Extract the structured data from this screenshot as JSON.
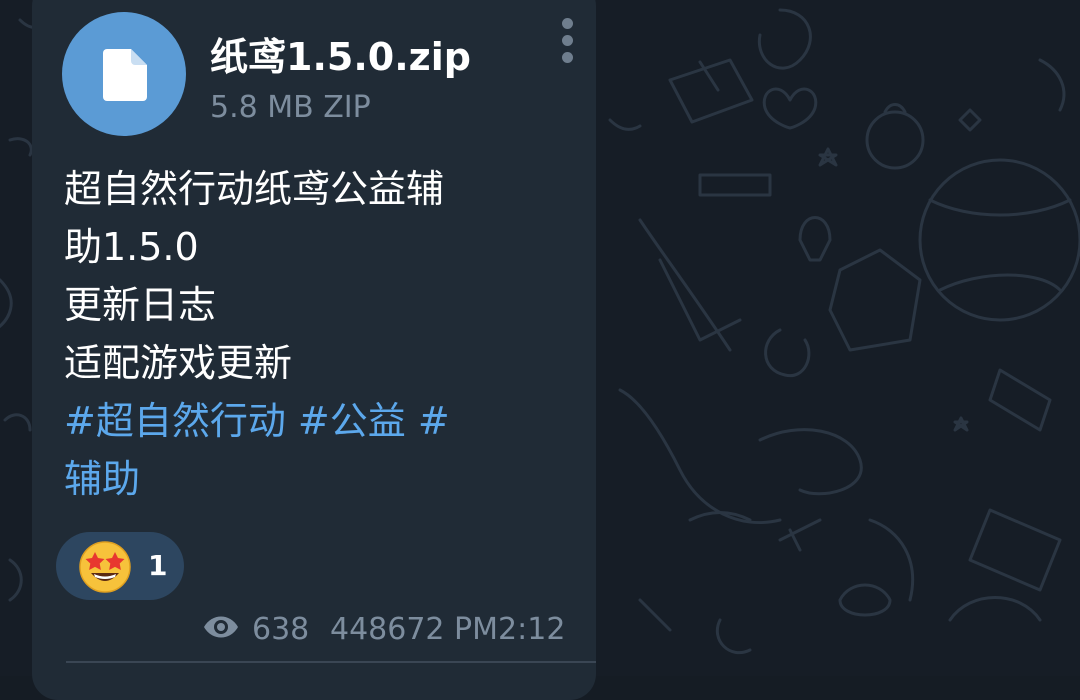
{
  "message": {
    "file": {
      "name": "纸鸢1.5.0.zip",
      "meta": "5.8 MB ZIP",
      "icon": "file-icon"
    },
    "caption_lines": [
      "超自然行动纸鸢公益辅",
      "助1.5.0",
      "更新日志",
      "适配游戏更新"
    ],
    "hashtag_lines": [
      "#超自然行动 #公益 #",
      "辅助"
    ],
    "reaction": {
      "emoji": "star-struck-emoji",
      "count": "1"
    },
    "views": "638",
    "timestamp": "448672 PM2:12"
  },
  "colors": {
    "bubble": "#202b36",
    "accent": "#5b9bd5",
    "link": "#5ca8ec",
    "muted": "#7d8d9e",
    "background": "#161d26"
  }
}
